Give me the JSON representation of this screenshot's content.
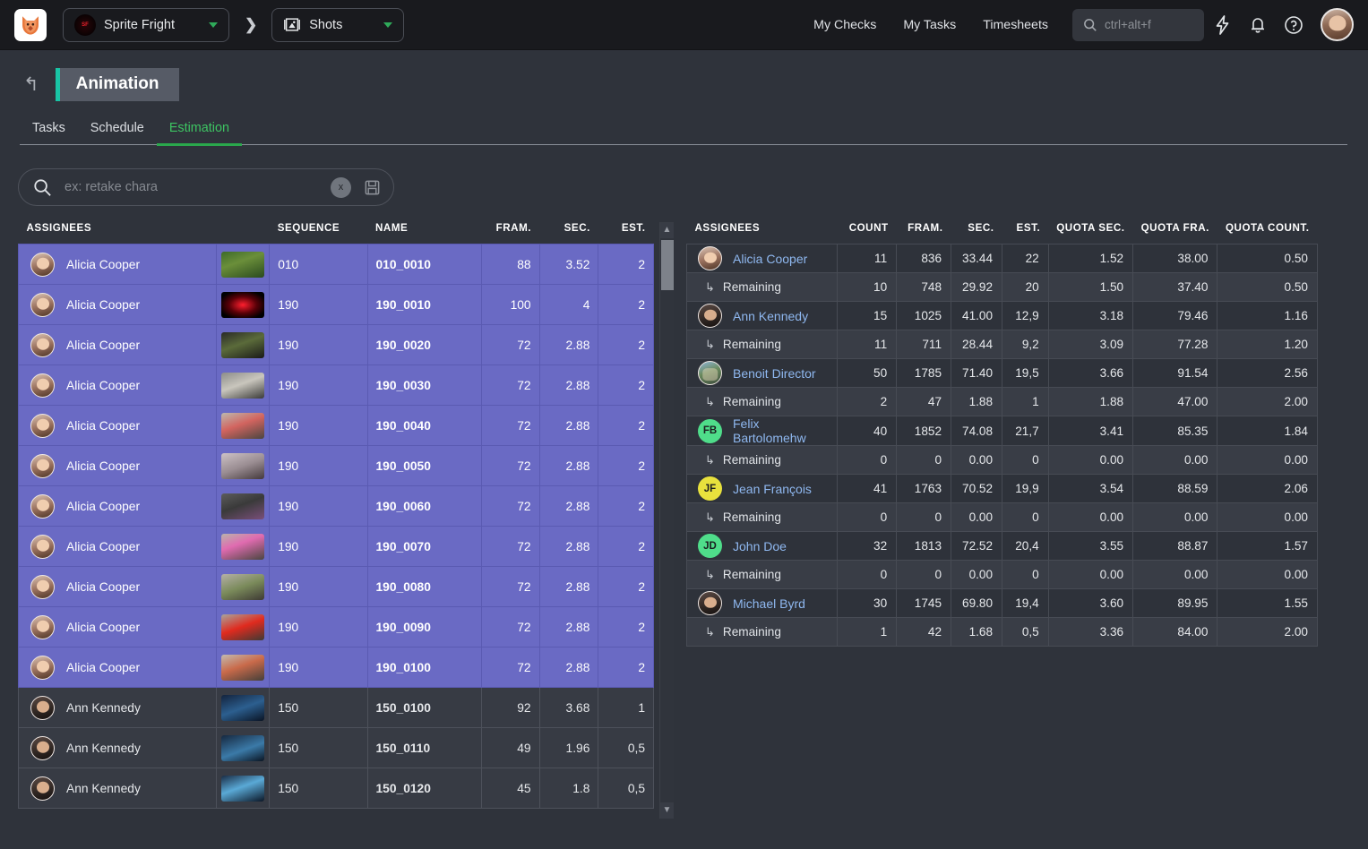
{
  "topbar": {
    "app_logo_icon": "fox-logo",
    "project": {
      "name": "Sprite Fright",
      "thumb_text": "SPRITE FRIGHT",
      "chevron_icon": "chevron-down-icon"
    },
    "separator_icon": "chevron-right-icon",
    "entity_type": {
      "name": "Shots",
      "icon": "film-strip-icon",
      "chevron_icon": "chevron-down-icon"
    },
    "nav": [
      {
        "label": "My Checks"
      },
      {
        "label": "My Tasks"
      },
      {
        "label": "Timesheets"
      }
    ],
    "search": {
      "placeholder": "ctrl+alt+f",
      "value": "",
      "icon": "search-icon"
    },
    "actions": [
      {
        "icon": "lightning-bolt-icon"
      },
      {
        "icon": "bell-icon"
      },
      {
        "icon": "help-circle-icon"
      }
    ],
    "avatar_icon": "user-avatar"
  },
  "page": {
    "back_icon": "back-arrow-icon",
    "title": "Animation",
    "accent_color": "#19c4a5"
  },
  "tabs": {
    "items": [
      {
        "label": "Tasks",
        "active": false
      },
      {
        "label": "Schedule",
        "active": false
      },
      {
        "label": "Estimation",
        "active": true
      }
    ],
    "active_color": "#3dc462"
  },
  "search_filter": {
    "icon": "search-icon",
    "placeholder": "ex: retake chara",
    "value": "",
    "clear_label": "x",
    "save_icon": "floppy-disk-icon"
  },
  "left_table": {
    "columns": [
      {
        "key": "assignees",
        "label": "ASSIGNEES",
        "align": "left"
      },
      {
        "key": "thumb",
        "label": "",
        "align": "left"
      },
      {
        "key": "sequence",
        "label": "SEQUENCE",
        "align": "left"
      },
      {
        "key": "name",
        "label": "NAME",
        "align": "left"
      },
      {
        "key": "frames",
        "label": "FRAM.",
        "align": "right"
      },
      {
        "key": "seconds",
        "label": "SEC.",
        "align": "right"
      },
      {
        "key": "estimation",
        "label": "EST.",
        "align": "right"
      }
    ],
    "rows": [
      {
        "assignee": "Alicia Cooper",
        "avatar": "photo",
        "sequence": "010",
        "name": "010_0010",
        "frames": "88",
        "seconds": "3.52",
        "estimation": "2",
        "selected": true,
        "thumb": "forest-character"
      },
      {
        "assignee": "Alicia Cooper",
        "avatar": "photo",
        "sequence": "190",
        "name": "190_0010",
        "frames": "100",
        "seconds": "4",
        "estimation": "2",
        "selected": true,
        "thumb": "title-card"
      },
      {
        "assignee": "Alicia Cooper",
        "avatar": "photo",
        "sequence": "190",
        "name": "190_0020",
        "frames": "72",
        "seconds": "2.88",
        "estimation": "2",
        "selected": true,
        "thumb": "plant"
      },
      {
        "assignee": "Alicia Cooper",
        "avatar": "photo",
        "sequence": "190",
        "name": "190_0030",
        "frames": "72",
        "seconds": "2.88",
        "estimation": "2",
        "selected": true,
        "thumb": "vase"
      },
      {
        "assignee": "Alicia Cooper",
        "avatar": "photo",
        "sequence": "190",
        "name": "190_0040",
        "frames": "72",
        "seconds": "2.88",
        "estimation": "2",
        "selected": true,
        "thumb": "flowers"
      },
      {
        "assignee": "Alicia Cooper",
        "avatar": "photo",
        "sequence": "190",
        "name": "190_0050",
        "frames": "72",
        "seconds": "2.88",
        "estimation": "2",
        "selected": true,
        "thumb": "room"
      },
      {
        "assignee": "Alicia Cooper",
        "avatar": "photo",
        "sequence": "190",
        "name": "190_0060",
        "frames": "72",
        "seconds": "2.88",
        "estimation": "2",
        "selected": true,
        "thumb": "dark-scene"
      },
      {
        "assignee": "Alicia Cooper",
        "avatar": "photo",
        "sequence": "190",
        "name": "190_0070",
        "frames": "72",
        "seconds": "2.88",
        "estimation": "2",
        "selected": true,
        "thumb": "pink-flower"
      },
      {
        "assignee": "Alicia Cooper",
        "avatar": "photo",
        "sequence": "190",
        "name": "190_0080",
        "frames": "72",
        "seconds": "2.88",
        "estimation": "2",
        "selected": true,
        "thumb": "tabletop"
      },
      {
        "assignee": "Alicia Cooper",
        "avatar": "photo",
        "sequence": "190",
        "name": "190_0090",
        "frames": "72",
        "seconds": "2.88",
        "estimation": "2",
        "selected": true,
        "thumb": "red-object"
      },
      {
        "assignee": "Alicia Cooper",
        "avatar": "photo",
        "sequence": "190",
        "name": "190_0100",
        "frames": "72",
        "seconds": "2.88",
        "estimation": "2",
        "selected": true,
        "thumb": "still-life"
      },
      {
        "assignee": "Ann Kennedy",
        "avatar": "photo2",
        "sequence": "150",
        "name": "150_0100",
        "frames": "92",
        "seconds": "3.68",
        "estimation": "1",
        "selected": false,
        "thumb": "night-blue"
      },
      {
        "assignee": "Ann Kennedy",
        "avatar": "photo2",
        "sequence": "150",
        "name": "150_0110",
        "frames": "49",
        "seconds": "1.96",
        "estimation": "0,5",
        "selected": false,
        "thumb": "night-blue2"
      },
      {
        "assignee": "Ann Kennedy",
        "avatar": "photo2",
        "sequence": "150",
        "name": "150_0120",
        "frames": "45",
        "seconds": "1.8",
        "estimation": "0,5",
        "selected": false,
        "thumb": "night-blue3"
      }
    ]
  },
  "scrollbar": {
    "up_icon": "chevron-up-icon",
    "down_icon": "chevron-down-icon"
  },
  "right_table": {
    "columns": [
      {
        "key": "assignees",
        "label": "ASSIGNEES",
        "align": "left"
      },
      {
        "key": "count",
        "label": "COUNT",
        "align": "right"
      },
      {
        "key": "frames",
        "label": "FRAM.",
        "align": "right"
      },
      {
        "key": "seconds",
        "label": "SEC.",
        "align": "right"
      },
      {
        "key": "estimation",
        "label": "EST.",
        "align": "right"
      },
      {
        "key": "quota_sec",
        "label": "QUOTA SEC.",
        "align": "right"
      },
      {
        "key": "quota_fra",
        "label": "QUOTA FRA.",
        "align": "right"
      },
      {
        "key": "quota_count",
        "label": "QUOTA COUNT.",
        "align": "right"
      }
    ],
    "rows": [
      {
        "type": "person",
        "name": "Alicia Cooper",
        "avatar": "photo",
        "count": "11",
        "frames": "836",
        "seconds": "33.44",
        "estimation": "22",
        "quota_sec": "1.52",
        "quota_fra": "38.00",
        "quota_count": "0.50"
      },
      {
        "type": "sub",
        "name": "Remaining",
        "count": "10",
        "frames": "748",
        "seconds": "29.92",
        "estimation": "20",
        "quota_sec": "1.50",
        "quota_fra": "37.40",
        "quota_count": "0.50"
      },
      {
        "type": "person",
        "name": "Ann Kennedy",
        "avatar": "photo2",
        "count": "15",
        "frames": "1025",
        "seconds": "41.00",
        "estimation": "12,9",
        "quota_sec": "3.18",
        "quota_fra": "79.46",
        "quota_count": "1.16"
      },
      {
        "type": "sub",
        "name": "Remaining",
        "count": "11",
        "frames": "711",
        "seconds": "28.44",
        "estimation": "9,2",
        "quota_sec": "3.09",
        "quota_fra": "77.28",
        "quota_count": "1.20"
      },
      {
        "type": "person",
        "name": "Benoit Director",
        "avatar": "scene",
        "count": "50",
        "frames": "1785",
        "seconds": "71.40",
        "estimation": "19,5",
        "quota_sec": "3.66",
        "quota_fra": "91.54",
        "quota_count": "2.56"
      },
      {
        "type": "sub",
        "name": "Remaining",
        "count": "2",
        "frames": "47",
        "seconds": "1.88",
        "estimation": "1",
        "quota_sec": "1.88",
        "quota_fra": "47.00",
        "quota_count": "2.00"
      },
      {
        "type": "person",
        "name": "Felix Bartolomehw",
        "avatar": "initials",
        "initials": "FB",
        "avatar_color": "#4fdd8a",
        "count": "40",
        "frames": "1852",
        "seconds": "74.08",
        "estimation": "21,7",
        "quota_sec": "3.41",
        "quota_fra": "85.35",
        "quota_count": "1.84"
      },
      {
        "type": "sub",
        "name": "Remaining",
        "count": "0",
        "frames": "0",
        "seconds": "0.00",
        "estimation": "0",
        "quota_sec": "0.00",
        "quota_fra": "0.00",
        "quota_count": "0.00"
      },
      {
        "type": "person",
        "name": "Jean François",
        "avatar": "initials",
        "initials": "JF",
        "avatar_color": "#e8e13d",
        "count": "41",
        "frames": "1763",
        "seconds": "70.52",
        "estimation": "19,9",
        "quota_sec": "3.54",
        "quota_fra": "88.59",
        "quota_count": "2.06"
      },
      {
        "type": "sub",
        "name": "Remaining",
        "count": "0",
        "frames": "0",
        "seconds": "0.00",
        "estimation": "0",
        "quota_sec": "0.00",
        "quota_fra": "0.00",
        "quota_count": "0.00"
      },
      {
        "type": "person",
        "name": "John Doe",
        "avatar": "initials",
        "initials": "JD",
        "avatar_color": "#4fdd8a",
        "count": "32",
        "frames": "1813",
        "seconds": "72.52",
        "estimation": "20,4",
        "quota_sec": "3.55",
        "quota_fra": "88.87",
        "quota_count": "1.57"
      },
      {
        "type": "sub",
        "name": "Remaining",
        "count": "0",
        "frames": "0",
        "seconds": "0.00",
        "estimation": "0",
        "quota_sec": "0.00",
        "quota_fra": "0.00",
        "quota_count": "0.00"
      },
      {
        "type": "person",
        "name": "Michael Byrd",
        "avatar": "beard",
        "count": "30",
        "frames": "1745",
        "seconds": "69.80",
        "estimation": "19,4",
        "quota_sec": "3.60",
        "quota_fra": "89.95",
        "quota_count": "1.55"
      },
      {
        "type": "sub",
        "name": "Remaining",
        "count": "1",
        "frames": "42",
        "seconds": "1.68",
        "estimation": "0,5",
        "quota_sec": "3.36",
        "quota_fra": "84.00",
        "quota_count": "2.00"
      }
    ]
  }
}
